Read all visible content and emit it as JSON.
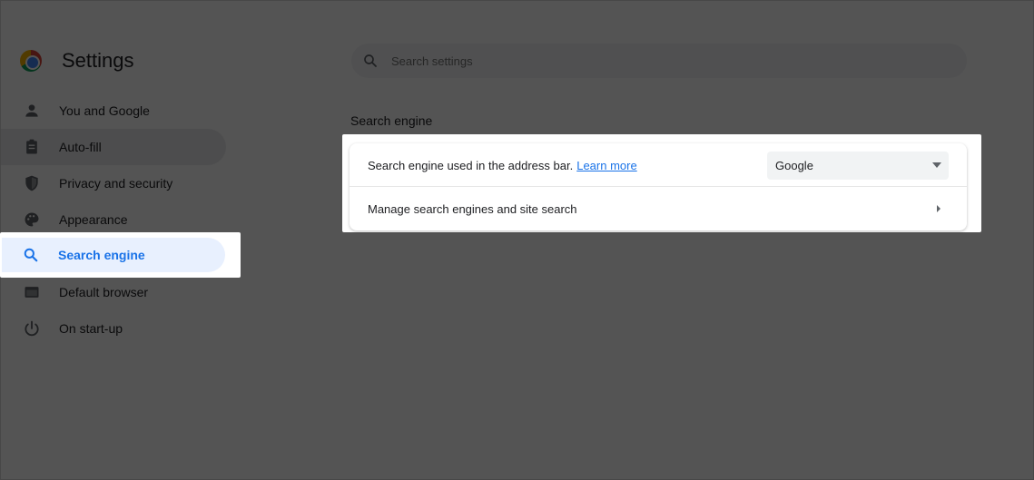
{
  "header": {
    "title": "Settings",
    "logo_icon": "chrome-logo-icon"
  },
  "search": {
    "placeholder": "Search settings",
    "icon": "search-icon"
  },
  "sidebar": {
    "items": [
      {
        "label": "You and Google",
        "icon": "person-icon"
      },
      {
        "label": "Auto-fill",
        "icon": "clipboard-icon"
      },
      {
        "label": "Privacy and security",
        "icon": "shield-icon"
      },
      {
        "label": "Appearance",
        "icon": "palette-icon"
      },
      {
        "label": "Search engine",
        "icon": "search-icon",
        "selected": true
      },
      {
        "label": "Default browser",
        "icon": "browser-icon"
      },
      {
        "label": "On start-up",
        "icon": "power-icon"
      }
    ]
  },
  "main": {
    "section_title": "Search engine",
    "row1": {
      "label": "Search engine used in the address bar.",
      "link": "Learn more",
      "select_value": "Google"
    },
    "row2": {
      "label": "Manage search engines and site search"
    }
  },
  "colors": {
    "accent": "#1a73e8",
    "selected_bg": "#e8f0fe",
    "overlay": "#000000"
  }
}
